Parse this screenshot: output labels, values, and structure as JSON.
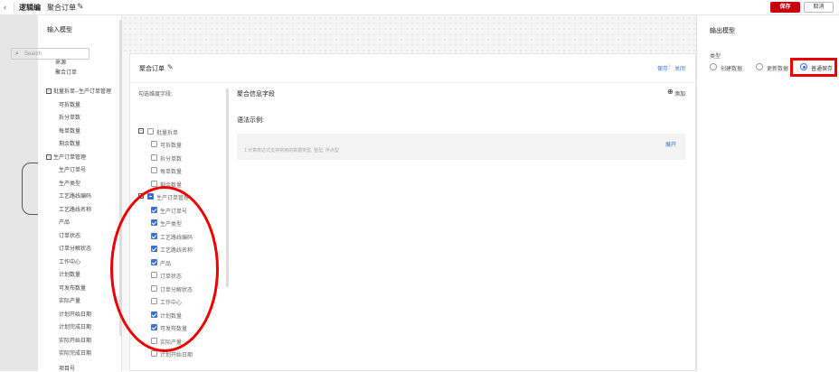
{
  "topbar": {
    "back_icon": "chevron-left-icon",
    "breadcrumb": "逻辑编",
    "title": "聚合订单",
    "save_label": "保存",
    "cancel_label": "取消",
    "colors": {
      "primary": "#c7000b"
    }
  },
  "input_panel": {
    "title": "输入模型",
    "source_label": "来源",
    "source_value": "聚合订单",
    "groups": [
      {
        "label": "批量拆单--生产订单管理",
        "items": [
          "可拆数量",
          "拆分单数",
          "每单数量",
          "剩余数量"
        ]
      },
      {
        "label": "生产订单管理",
        "items": [
          "生产订单号",
          "生产类型",
          "工艺路线编码",
          "工艺路线名称",
          "产品",
          "订单状态",
          "订单分解状态",
          "工作中心",
          "计划数量",
          "可发布数量",
          "实际产量",
          "计划开始日期",
          "计划完成日期",
          "实际开始日期",
          "实际完成日期",
          "项目号"
        ]
      }
    ]
  },
  "aggregate": {
    "title": "聚合订单",
    "save_label": "保存",
    "close_label": "关闭",
    "field_title": "勾选维度字段:",
    "search_placeholder": "Search",
    "groups": [
      {
        "label": "批量拆单",
        "state": "none",
        "items": [
          {
            "label": "可拆数量",
            "checked": false
          },
          {
            "label": "拆分单数",
            "checked": false
          },
          {
            "label": "每单数量",
            "checked": false
          },
          {
            "label": "剩余数量",
            "checked": false
          }
        ]
      },
      {
        "label": "生产订单管理",
        "state": "partial",
        "items": [
          {
            "label": "生产订单号",
            "checked": true
          },
          {
            "label": "生产类型",
            "checked": true
          },
          {
            "label": "工艺路线编码",
            "checked": true
          },
          {
            "label": "工艺路线名称",
            "checked": true
          },
          {
            "label": "产品",
            "checked": true
          },
          {
            "label": "订单状态",
            "checked": false
          },
          {
            "label": "订单分解状态",
            "checked": false
          },
          {
            "label": "工作中心",
            "checked": false
          },
          {
            "label": "计划数量",
            "checked": true
          },
          {
            "label": "可发布数量",
            "checked": true
          },
          {
            "label": "实际产量",
            "checked": false
          },
          {
            "label": "计划开始日期",
            "checked": false
          }
        ]
      }
    ],
    "info_title": "聚合信息字段",
    "add_label": "添加",
    "syntax_title": "语法示例:",
    "code_line": "1  计算表达式支持常用的数据类型, 整型, 浮点型",
    "expand_label": "展开"
  },
  "output_panel": {
    "title": "输出模型",
    "type_label": "类型",
    "options": [
      "创建数据",
      "更新数据",
      "普通保存"
    ],
    "selected": "普通保存"
  }
}
